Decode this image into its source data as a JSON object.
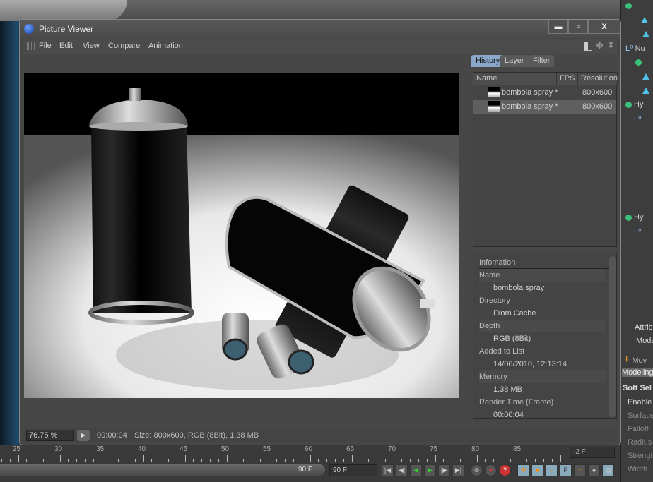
{
  "window": {
    "title": "Picture Viewer",
    "minimize": "▬",
    "maximize": "▫",
    "close": "X"
  },
  "menu": [
    "File",
    "Edit",
    "View",
    "Compare",
    "Animation"
  ],
  "panel": {
    "tabs": [
      "History",
      "Layer",
      "Filter"
    ],
    "active_tab": "History",
    "columns": [
      "Name",
      "FPS",
      "Resolution"
    ],
    "rows": [
      {
        "name": "bombola spray *",
        "fps": "",
        "resolution": "800x600"
      },
      {
        "name": "bombola spray *",
        "fps": "",
        "resolution": "800x600",
        "selected": true
      }
    ],
    "info": {
      "header": "Infomation",
      "fields": [
        {
          "label": "Name",
          "value": "bombola spray"
        },
        {
          "label": "Directory",
          "value": "From Cache"
        },
        {
          "label": "Depth",
          "value": "RGB (8Bit)"
        },
        {
          "label": "Added to List",
          "value": "14/06/2010, 12:13:14"
        },
        {
          "label": "Memory",
          "value": "1.38 MB"
        },
        {
          "label": "Render Time (Frame)",
          "value": "00:00:04"
        }
      ]
    }
  },
  "status": {
    "zoom": "76.75 %",
    "time": "00:00:04",
    "info": "Size: 800x600, RGB (8Bit), 1.38 MB"
  },
  "timeline": {
    "labels": [
      "25",
      "30",
      "35",
      "40",
      "45",
      "50",
      "55",
      "60",
      "65",
      "70",
      "75",
      "80",
      "85"
    ],
    "current": "-2 F",
    "end_slider": "90 F",
    "end_field": "90 F"
  },
  "object_manager": {
    "items": [
      "Nu",
      "Hy",
      "Hy"
    ]
  },
  "attributes": {
    "tab": "Attrib",
    "mode": "Mode",
    "move": "Mov",
    "modeling": "Modeling",
    "soft": "Soft Sel",
    "rows": [
      "Enable",
      "Surface",
      "Falloff",
      "Radius",
      "Strength",
      "Width"
    ]
  }
}
